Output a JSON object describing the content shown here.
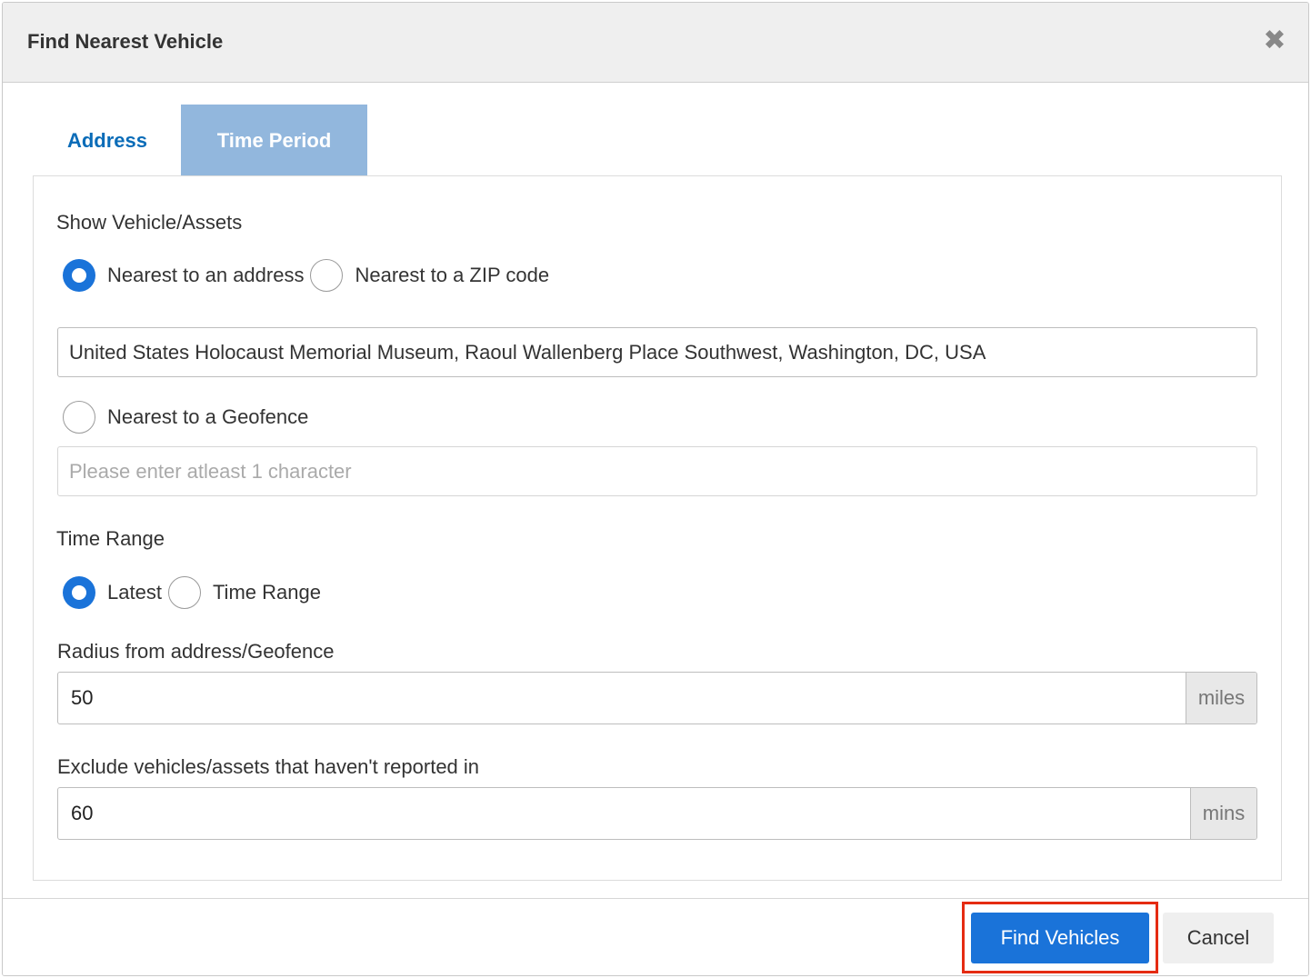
{
  "modal": {
    "title": "Find Nearest Vehicle",
    "close_glyph": "✖"
  },
  "tabs": [
    {
      "label": "Address",
      "active": false
    },
    {
      "label": "Time Period",
      "active": true
    }
  ],
  "show": {
    "heading": "Show Vehicle/Assets",
    "option_address": "Nearest to an address",
    "option_zip": "Nearest to a ZIP code",
    "selected": "address",
    "address_value": "United States Holocaust Memorial Museum, Raoul Wallenberg Place Southwest, Washington, DC, USA",
    "option_geofence": "Nearest to a Geofence",
    "geofence_placeholder": "Please enter atleast 1 character"
  },
  "time_range": {
    "heading": "Time Range",
    "option_latest": "Latest",
    "option_range": "Time Range",
    "selected": "latest"
  },
  "radius": {
    "label": "Radius from address/Geofence",
    "value": "50",
    "unit": "miles"
  },
  "exclude": {
    "label": "Exclude vehicles/assets that haven't reported in",
    "value": "60",
    "unit": "mins"
  },
  "footer": {
    "find_label": "Find Vehicles",
    "cancel_label": "Cancel"
  },
  "colors": {
    "primary": "#1a73d9",
    "active_tab": "#92b7dd",
    "tab_link": "#0a6cb8",
    "highlight": "#e52b12"
  }
}
